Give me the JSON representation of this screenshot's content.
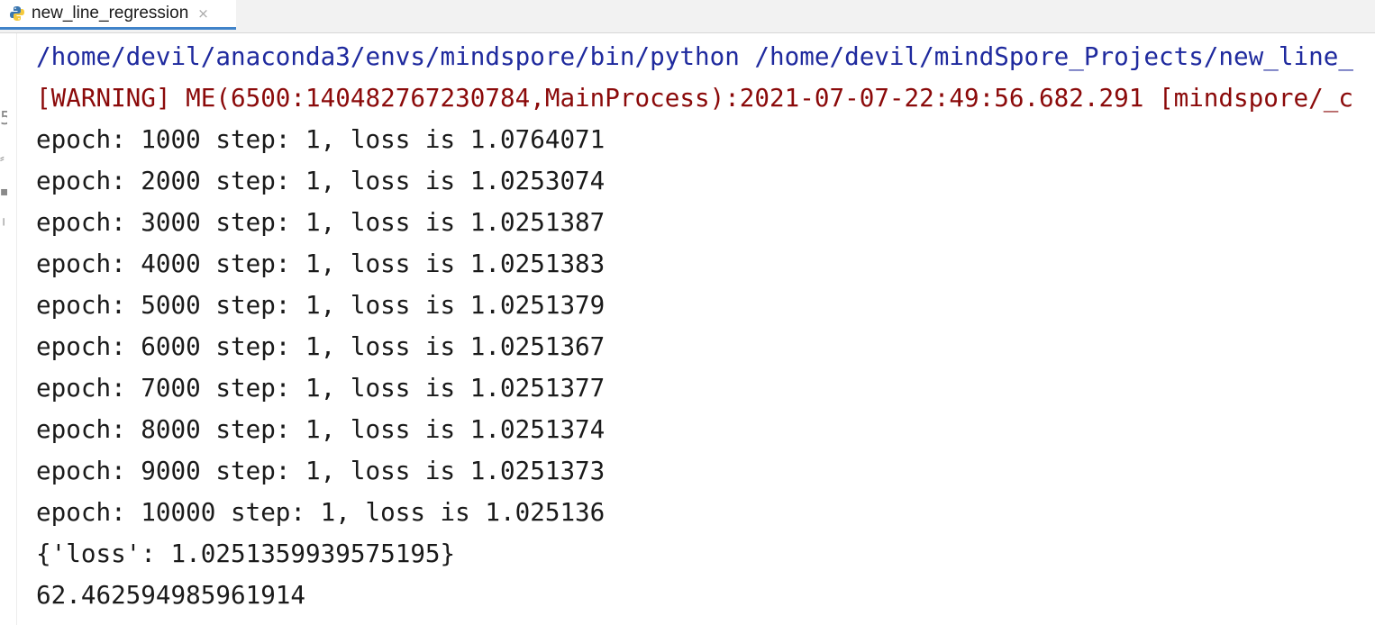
{
  "tab": {
    "title": "new_line_regression",
    "close_glyph": "×",
    "icon": "python-file-icon"
  },
  "console": {
    "command": "/home/devil/anaconda3/envs/mindspore/bin/python /home/devil/mindSpore_Projects/new_line_",
    "warning": "[WARNING] ME(6500:140482767230784,MainProcess):2021-07-07-22:49:56.682.291 [mindspore/_c",
    "output": [
      "epoch: 1000 step: 1, loss is 1.0764071",
      "epoch: 2000 step: 1, loss is 1.0253074",
      "epoch: 3000 step: 1, loss is 1.0251387",
      "epoch: 4000 step: 1, loss is 1.0251383",
      "epoch: 5000 step: 1, loss is 1.0251379",
      "epoch: 6000 step: 1, loss is 1.0251367",
      "epoch: 7000 step: 1, loss is 1.0251377",
      "epoch: 8000 step: 1, loss is 1.0251374",
      "epoch: 9000 step: 1, loss is 1.0251373",
      "epoch: 10000 step: 1, loss is 1.025136",
      "{'loss': 1.0251359939575195}",
      "62.462594985961914"
    ]
  },
  "colors": {
    "command": "#1f2a9e",
    "warning": "#8b0a0a",
    "output": "#1a1a1a",
    "tab_accent": "#4083c9"
  }
}
